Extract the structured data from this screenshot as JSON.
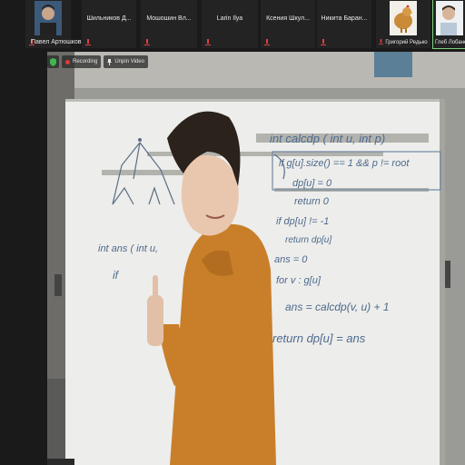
{
  "colors": {
    "strip_bg": "#1a1a1a",
    "tile_bg": "#232323",
    "name_text": "#e8e8e8",
    "muted_mic": "#e04040",
    "active_border": "#7dd07d"
  },
  "participants": [
    {
      "name": "Павел Артюшков",
      "muted": true,
      "has_avatar": true,
      "avatar_icon": "person-photo"
    },
    {
      "name": "Шильников Д...",
      "muted": true,
      "has_avatar": false
    },
    {
      "name": "Мошошин Вл...",
      "muted": true,
      "has_avatar": false
    },
    {
      "name": "Larin Ilya",
      "muted": true,
      "has_avatar": false
    },
    {
      "name": "Ксения Шкул...",
      "muted": true,
      "has_avatar": false
    },
    {
      "name": "Никита Баран...",
      "muted": true,
      "has_avatar": false
    },
    {
      "name": "Григорий Редько",
      "muted": true,
      "has_avatar": true,
      "avatar_icon": "chicken-photo"
    },
    {
      "name": "Глеб Лобанев",
      "muted": false,
      "has_avatar": true,
      "avatar_icon": "person-photo",
      "active": true
    }
  ],
  "recording": {
    "status_label": "Recording",
    "unpin_label": "Unpin Video"
  },
  "whiteboard": {
    "left_code": [
      "int ans ( int u,",
      "if"
    ],
    "right_code": [
      "int calcdp ( int u, int p)",
      "if g[u].size() == 1 && p != root",
      "dp[u] = 0",
      "return 0",
      "if dp[u] != -1",
      "return dp[u]",
      "ans = 0",
      "for v : g[u]",
      "ans = calcdp(v, u) + 1",
      "return dp[u] = ans"
    ]
  }
}
